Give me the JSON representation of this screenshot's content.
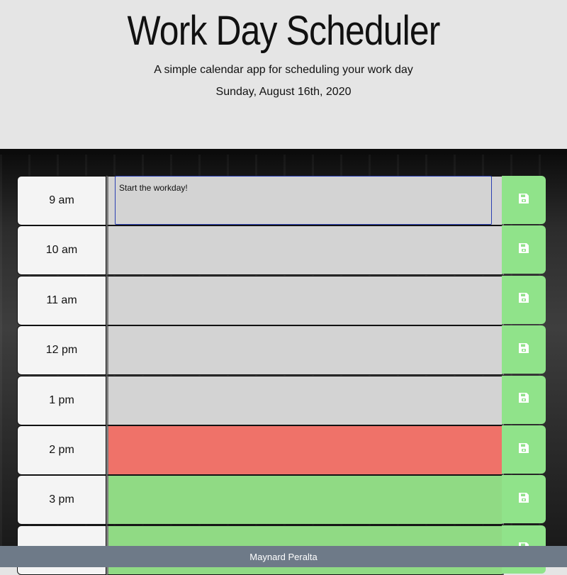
{
  "header": {
    "title": "Work Day Scheduler",
    "subtitle": "A simple calendar app for scheduling your work day",
    "current_date": "Sunday, August 16th, 2020"
  },
  "time_blocks": [
    {
      "hour": "9 am",
      "text": "Start the workday!",
      "state": "past",
      "focused": true
    },
    {
      "hour": "10 am",
      "text": "",
      "state": "past"
    },
    {
      "hour": "11 am",
      "text": "",
      "state": "past"
    },
    {
      "hour": "12 pm",
      "text": "",
      "state": "past"
    },
    {
      "hour": "1 pm",
      "text": "",
      "state": "past"
    },
    {
      "hour": "2 pm",
      "text": "",
      "state": "present"
    },
    {
      "hour": "3 pm",
      "text": "",
      "state": "future"
    },
    {
      "hour": "",
      "text": "",
      "state": "future"
    }
  ],
  "save_icon": "floppy-disk-icon",
  "colors": {
    "past": "#d3d3d3",
    "present": "#ef7269",
    "future": "#90da84",
    "save_button": "#90e38a",
    "footer": "#6e7a88"
  },
  "footer": {
    "text": "Maynard Peralta"
  }
}
